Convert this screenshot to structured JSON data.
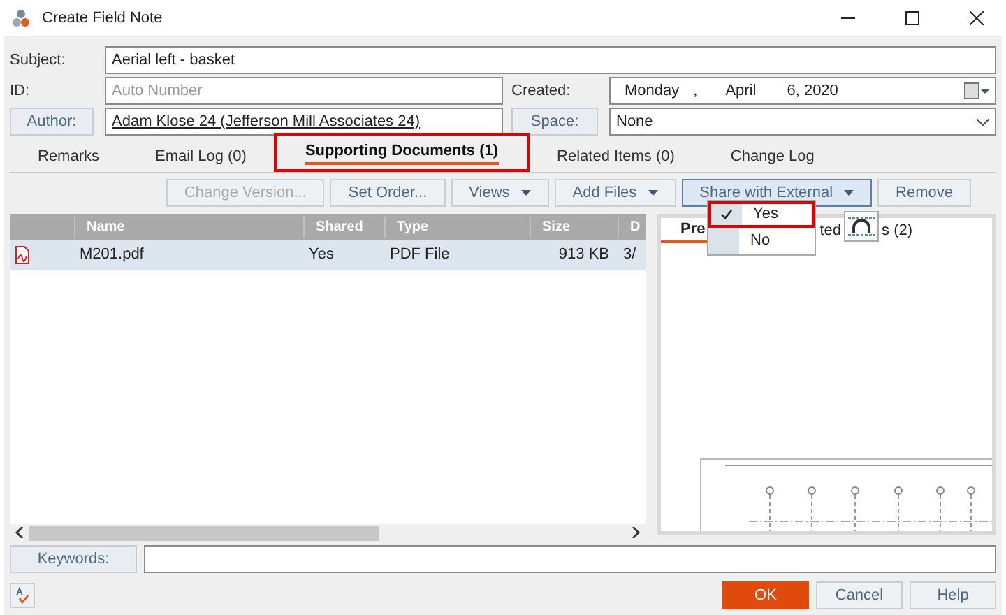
{
  "window": {
    "title": "Create Field Note"
  },
  "form": {
    "subject_label": "Subject:",
    "subject": "Aerial left - basket",
    "id_label": "ID:",
    "id_placeholder": "Auto Number",
    "created_label": "Created:",
    "created": [
      "Monday",
      ",",
      "April",
      "6, 2020"
    ],
    "author_button": "Author:",
    "author": "Adam Klose 24 (Jefferson Mill Associates 24)",
    "space_button": "Space:",
    "space": "None"
  },
  "tabs": [
    {
      "label": "Remarks",
      "selected": false
    },
    {
      "label": "Email Log (0)",
      "selected": false
    },
    {
      "label": "Supporting Documents (1)",
      "selected": true
    },
    {
      "label": "Related Items (0)",
      "selected": false
    },
    {
      "label": "Change Log",
      "selected": false
    }
  ],
  "toolbar": [
    {
      "label": "Change Version...",
      "disabled": true,
      "menu": false
    },
    {
      "label": "Set Order...",
      "disabled": false,
      "menu": false
    },
    {
      "label": "Views",
      "disabled": false,
      "menu": true
    },
    {
      "label": "Add Files",
      "disabled": false,
      "menu": true
    },
    {
      "label": "Share with External",
      "disabled": false,
      "menu": true,
      "open": true
    },
    {
      "label": "Remove",
      "disabled": false,
      "menu": false
    }
  ],
  "table": {
    "columns": [
      "Name",
      "Shared",
      "Type",
      "Size",
      "D"
    ],
    "rows": [
      {
        "selected": true,
        "cells": [
          "M201.pdf",
          "Yes",
          "PDF File",
          "913 KB",
          "3/"
        ]
      }
    ]
  },
  "share_menu": [
    {
      "label": "Yes",
      "checked": true
    },
    {
      "label": "No",
      "checked": false
    }
  ],
  "preview_tabs": [
    {
      "parts": [
        "Pre"
      ],
      "selected": true
    },
    {
      "parts": [
        "ted",
        "s (2)"
      ],
      "selected": false
    }
  ],
  "keywords": {
    "label": "Keywords:"
  },
  "buttons": [
    {
      "label": "OK",
      "primary": true
    },
    {
      "label": "Cancel",
      "primary": false
    },
    {
      "label": "Help",
      "primary": false
    }
  ]
}
